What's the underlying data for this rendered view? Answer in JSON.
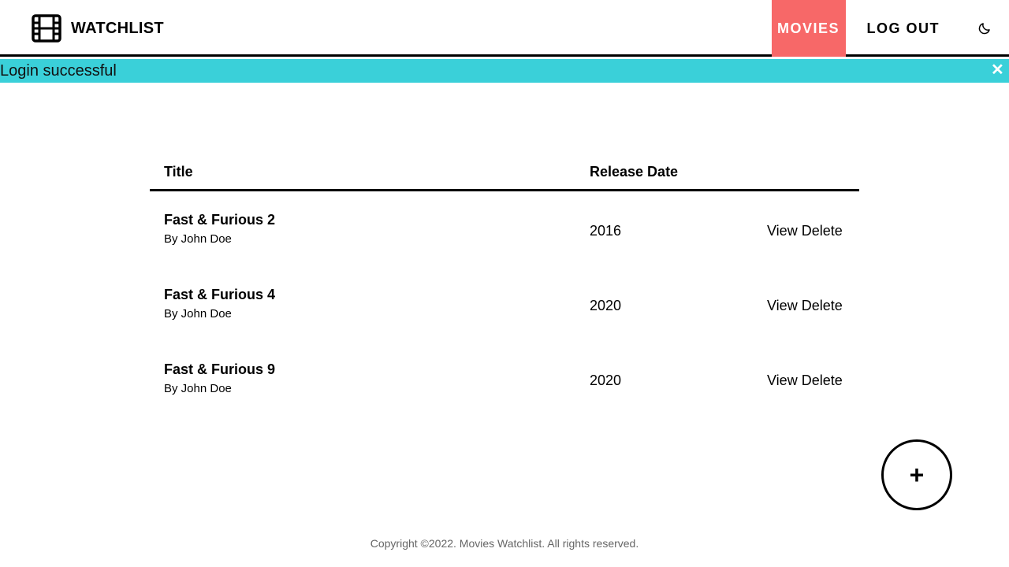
{
  "brand": {
    "name": "WATCHLIST",
    "icon": "film-icon"
  },
  "nav": {
    "movies_label": "MOVIES",
    "logout_label": "LOG OUT",
    "theme_icon": "moon-icon"
  },
  "alert": {
    "message": "Login successful",
    "close_symbol": "✕"
  },
  "table": {
    "columns": {
      "title": "Title",
      "release_date": "Release Date"
    },
    "rows": [
      {
        "title": "Fast & Furious 2",
        "author": "By John Doe",
        "year": "2016",
        "view_label": "View",
        "delete_label": "Delete"
      },
      {
        "title": "Fast & Furious 4",
        "author": "By John Doe",
        "year": "2020",
        "view_label": "View",
        "delete_label": "Delete"
      },
      {
        "title": "Fast & Furious 9",
        "author": "By John Doe",
        "year": "2020",
        "view_label": "View",
        "delete_label": "Delete"
      }
    ]
  },
  "fab": {
    "symbol": "+"
  },
  "footer": {
    "copyright": "Copyright ©2022. Movies Watchlist. All rights reserved."
  },
  "colors": {
    "active_nav": "#f76868",
    "alert_bg": "#3ad0d9",
    "footer_text": "#666666"
  }
}
